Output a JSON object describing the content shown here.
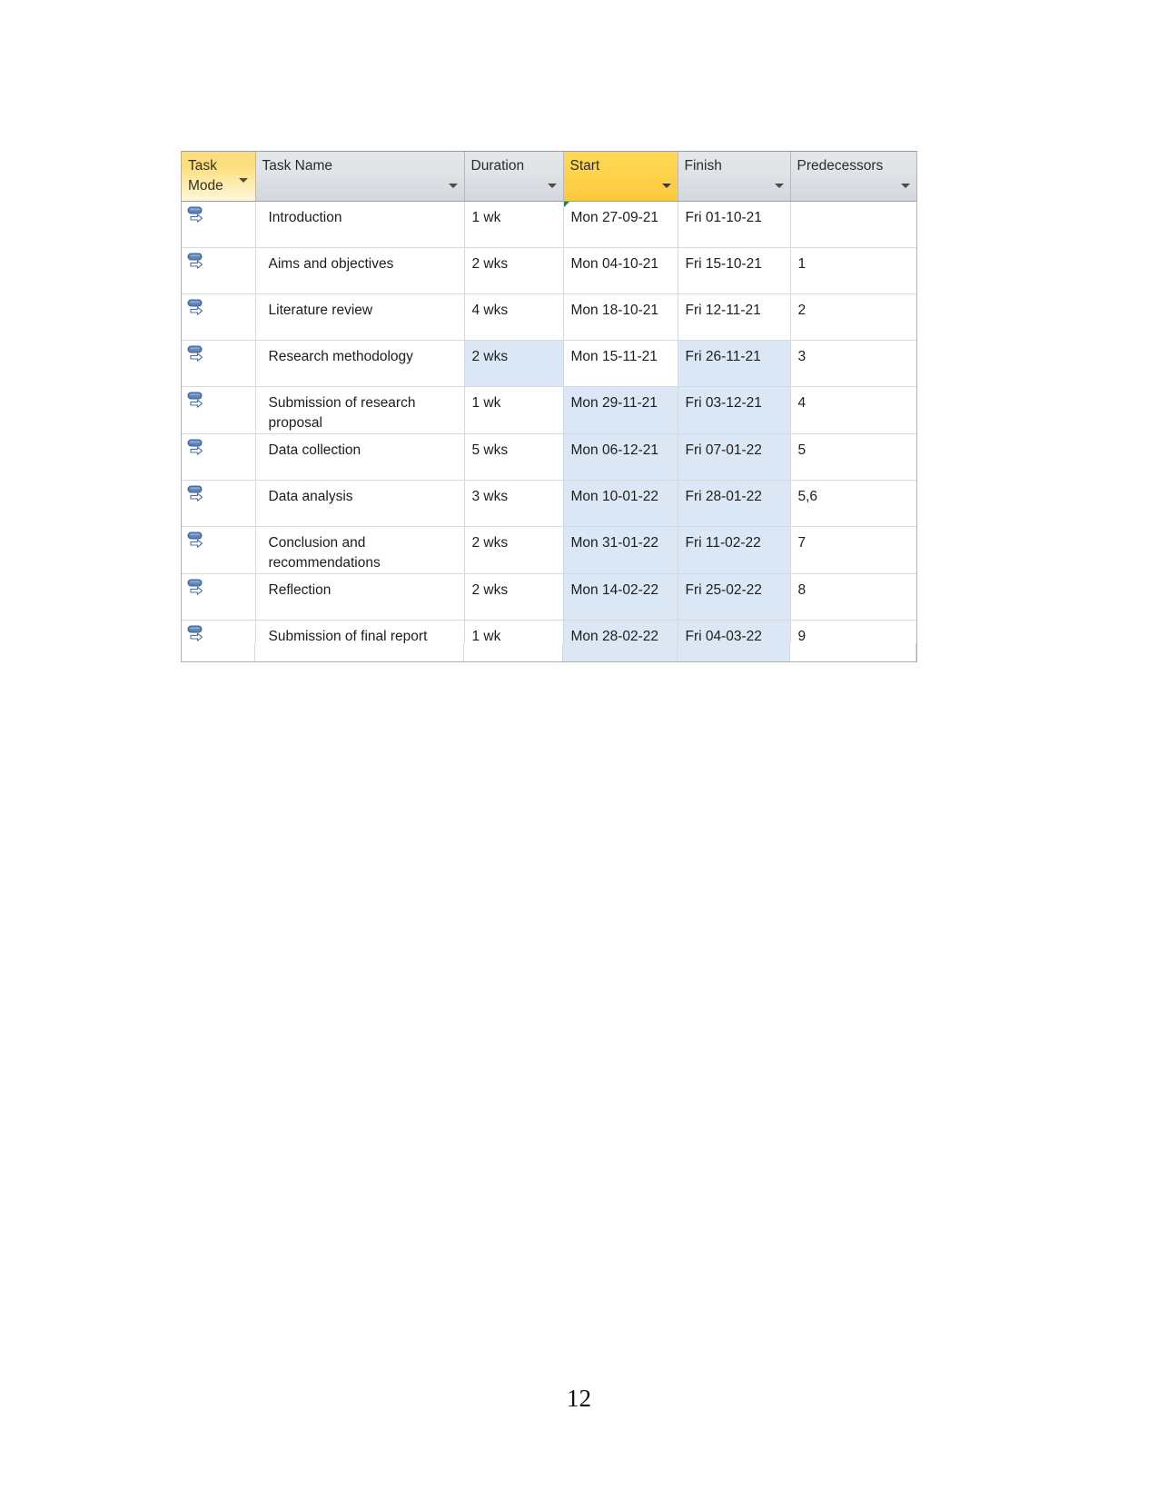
{
  "document": {
    "page_number": "12"
  },
  "table": {
    "columns": [
      {
        "key": "task_mode",
        "label": "Task\nMode",
        "header_style": "gold-gradient",
        "has_filter": true
      },
      {
        "key": "task_name",
        "label": "Task Name",
        "header_style": "gray",
        "has_filter": true
      },
      {
        "key": "duration",
        "label": "Duration",
        "header_style": "gray",
        "has_filter": true
      },
      {
        "key": "start",
        "label": "Start",
        "header_style": "gold",
        "has_filter": true
      },
      {
        "key": "finish",
        "label": "Finish",
        "header_style": "gray",
        "has_filter": true
      },
      {
        "key": "predecessors",
        "label": "Predecessors",
        "header_style": "gray",
        "has_filter": false
      }
    ],
    "task_mode_icon": "auto-scheduled-icon",
    "rows": [
      {
        "task_mode": "auto-scheduled-icon",
        "task_name": "Introduction",
        "duration": "1 wk",
        "start": "Mon 27-09-21",
        "finish": "Fri 01-10-21",
        "predecessors": "",
        "start_marker": true,
        "selected": {
          "duration": false,
          "start": false,
          "finish": false
        }
      },
      {
        "task_mode": "auto-scheduled-icon",
        "task_name": "Aims and objectives",
        "duration": "2 wks",
        "start": "Mon 04-10-21",
        "finish": "Fri 15-10-21",
        "predecessors": "1",
        "start_marker": false,
        "selected": {
          "duration": false,
          "start": false,
          "finish": false
        }
      },
      {
        "task_mode": "auto-scheduled-icon",
        "task_name": "Literature review",
        "duration": "4 wks",
        "start": "Mon 18-10-21",
        "finish": "Fri 12-11-21",
        "predecessors": "2",
        "start_marker": false,
        "selected": {
          "duration": false,
          "start": false,
          "finish": false
        }
      },
      {
        "task_mode": "auto-scheduled-icon",
        "task_name": "Research methodology",
        "duration": "2 wks",
        "start": "Mon 15-11-21",
        "finish": "Fri 26-11-21",
        "predecessors": "3",
        "start_marker": false,
        "selected": {
          "duration": true,
          "start": false,
          "finish": true
        }
      },
      {
        "task_mode": "auto-scheduled-icon",
        "task_name": "Submission of research proposal",
        "duration": "1 wk",
        "start": "Mon 29-11-21",
        "finish": "Fri 03-12-21",
        "predecessors": "4",
        "start_marker": false,
        "selected": {
          "duration": false,
          "start": true,
          "finish": true
        }
      },
      {
        "task_mode": "auto-scheduled-icon",
        "task_name": "Data collection",
        "duration": "5 wks",
        "start": "Mon 06-12-21",
        "finish": "Fri 07-01-22",
        "predecessors": "5",
        "start_marker": false,
        "selected": {
          "duration": false,
          "start": true,
          "finish": true
        }
      },
      {
        "task_mode": "auto-scheduled-icon",
        "task_name": "Data analysis",
        "duration": "3 wks",
        "start": "Mon 10-01-22",
        "finish": "Fri 28-01-22",
        "predecessors": "5,6",
        "start_marker": false,
        "selected": {
          "duration": false,
          "start": true,
          "finish": true
        }
      },
      {
        "task_mode": "auto-scheduled-icon",
        "task_name": "Conclusion and recommendations",
        "duration": "2 wks",
        "start": "Mon 31-01-22",
        "finish": "Fri 11-02-22",
        "predecessors": "7",
        "start_marker": false,
        "selected": {
          "duration": false,
          "start": true,
          "finish": true
        }
      },
      {
        "task_mode": "auto-scheduled-icon",
        "task_name": "Reflection",
        "duration": "2 wks",
        "start": "Mon 14-02-22",
        "finish": "Fri 25-02-22",
        "predecessors": "8",
        "start_marker": false,
        "selected": {
          "duration": false,
          "start": true,
          "finish": true
        }
      },
      {
        "task_mode": "auto-scheduled-icon",
        "task_name": "Submission of final report",
        "duration": "1 wk",
        "start": "Mon 28-02-22",
        "finish": "Fri 04-03-22",
        "predecessors": "9",
        "start_marker": false,
        "selected": {
          "duration": false,
          "start": true,
          "finish": true
        }
      }
    ]
  },
  "colors": {
    "header_gray": "#dfe3e7",
    "header_gold": "#ffd24b",
    "header_gold_gradient": "#fbdf7e",
    "selection_blue": "#dce7f5",
    "grid_line": "#d6dade",
    "table_border": "#b0b0b0",
    "start_marker_green": "#1f8a2e",
    "icon_blue": "#5a7fb8",
    "text": "#1d1d1d"
  }
}
